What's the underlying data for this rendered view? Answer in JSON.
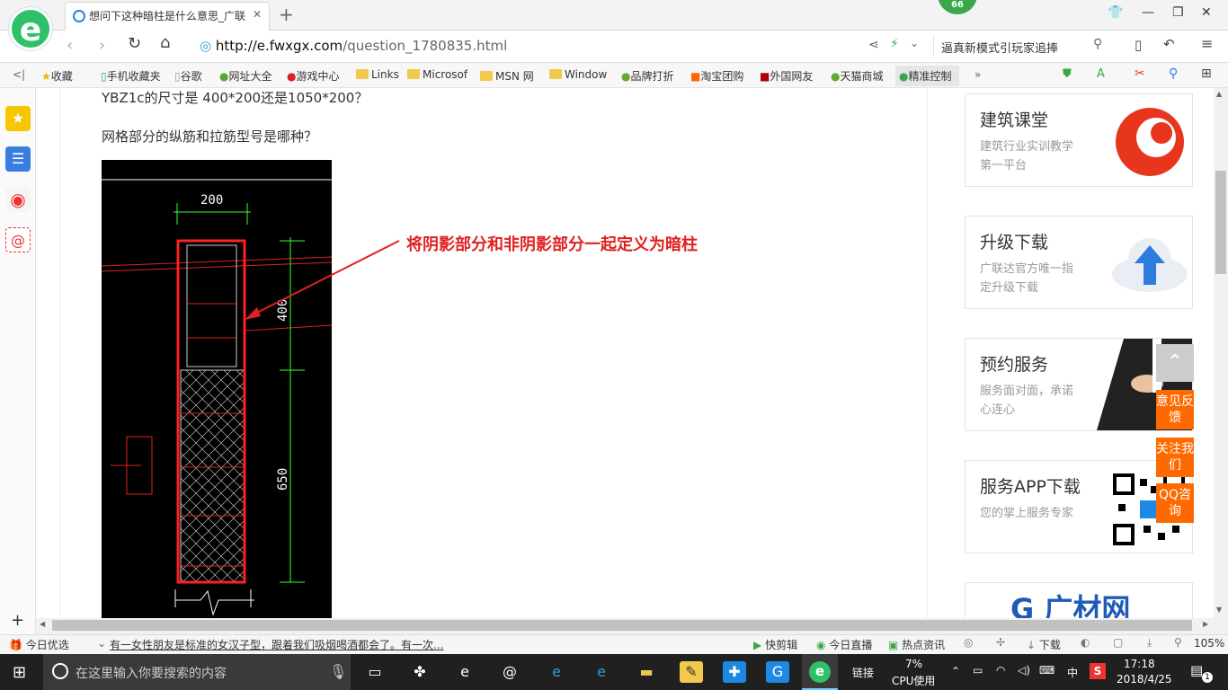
{
  "browser": {
    "tab_title": "想问下这种暗柱是什么意思_广联",
    "tab_close": "✕",
    "new_tab": "+",
    "badge": "66",
    "url_host": "http://e.fwxgx.com",
    "url_path": "/question_1780835.html",
    "search_text": "逼真新模式引玩家追捧"
  },
  "bookmarks": [
    "收藏",
    "手机收藏夹",
    "谷歌",
    "网址大全",
    "游戏中心",
    "Links",
    "Microsof",
    "MSN 网",
    "Window",
    "品牌打折",
    "淘宝团购",
    "外国网友",
    "天猫商城",
    "精准控制"
  ],
  "content": {
    "line1": "YBZ1c的尺寸是  400*200还是1050*200？",
    "line2": "网格部分的纵筋和拉筋型号是哪种？",
    "annotation": "将阴影部分和非阴影部分一起定义为暗柱",
    "cad": {
      "dim_top": "200",
      "dim_upper": "400",
      "dim_lower": "650"
    }
  },
  "sidebar_cards": [
    {
      "title": "建筑课堂",
      "desc": "建筑行业实训教学第一平台"
    },
    {
      "title": "升级下载",
      "desc": "广联达官方唯一指定升级下载"
    },
    {
      "title": "预约服务",
      "desc": "服务面对面，承诺心连心"
    },
    {
      "title": "服务APP下载",
      "desc": "您的掌上服务专家"
    }
  ],
  "brand_banner": "广材网",
  "float_buttons": [
    "意见反馈",
    "关注我们",
    "QQ咨询"
  ],
  "statusbar": {
    "today": "今日优选",
    "news": "有一女性朋友是标准的女汉子型，跟着我们吸烟喝酒都会了。有一次...",
    "quick_cut": "快剪辑",
    "live": "今日直播",
    "hot": "热点资讯",
    "download": "下载",
    "zoom": "105%"
  },
  "taskbar": {
    "search_placeholder": "在这里输入你要搜索的内容",
    "link_label": "链接",
    "cpu_percent": "7%",
    "cpu_label": "CPU使用",
    "ime": "中",
    "time": "17:18",
    "date": "2018/4/25",
    "notif_count": "1"
  },
  "colors": {
    "accent": "#ff6a00",
    "annotation": "#e02020",
    "cad_bg": "#000000",
    "taskbar": "#202020"
  }
}
